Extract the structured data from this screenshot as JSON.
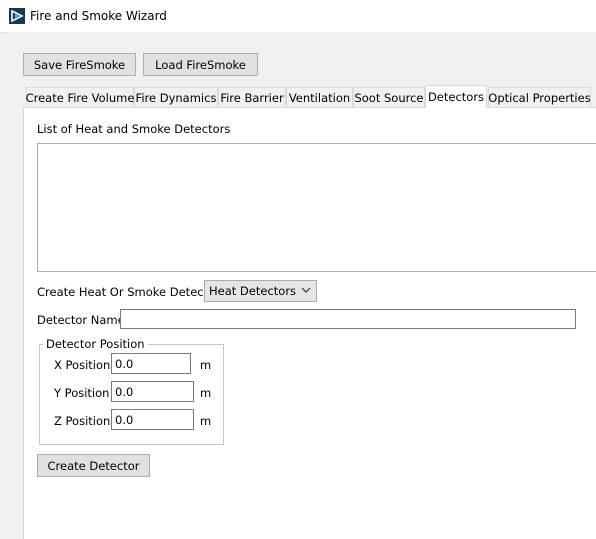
{
  "window": {
    "title": "Fire and Smoke Wizard"
  },
  "toolbar": {
    "save_label": "Save FireSmoke",
    "load_label": "Load FireSmoke"
  },
  "tabs": [
    {
      "label": "Create Fire Volume"
    },
    {
      "label": "Fire Dynamics"
    },
    {
      "label": "Fire Barrier"
    },
    {
      "label": "Ventilation"
    },
    {
      "label": "Soot Source"
    },
    {
      "label": "Detectors",
      "active": true
    },
    {
      "label": "Optical Properties"
    }
  ],
  "detectors": {
    "list_label": "List of Heat and Smoke Detectors",
    "create_type_label": "Create Heat Or Smoke Detector",
    "create_type_value": "Heat Detectors",
    "name_label": "Detector Name",
    "name_value": "",
    "position_group_label": "Detector Position",
    "x_label": "X Position",
    "x_value": "0.0",
    "y_label": "Y Position",
    "y_value": "0.0",
    "z_label": "Z Position",
    "z_value": "0.0",
    "unit": "m",
    "create_button": "Create Detector"
  }
}
